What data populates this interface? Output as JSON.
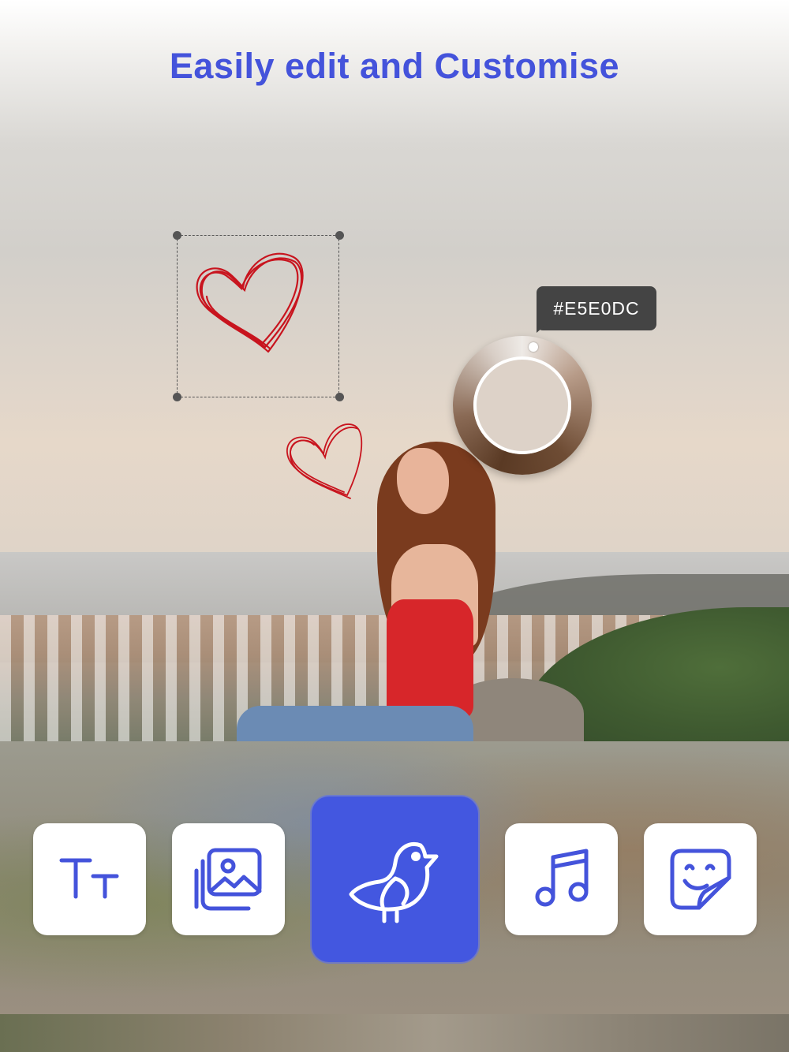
{
  "headline": "Easily edit and Customise",
  "color_picker": {
    "hex_label": "#E5E0DC",
    "selected_color": "#E5E0DC"
  },
  "colors": {
    "accent": "#4453DB",
    "active_tool_bg": "#4357E0",
    "heart_stroke": "#C8141E"
  },
  "toolbar": {
    "tools": [
      {
        "id": "text",
        "icon": "text-size-icon",
        "active": false
      },
      {
        "id": "images",
        "icon": "photo-gallery-icon",
        "active": false
      },
      {
        "id": "animals",
        "icon": "bird-icon",
        "active": true
      },
      {
        "id": "music",
        "icon": "music-note-icon",
        "active": false
      },
      {
        "id": "stickers",
        "icon": "sticker-icon",
        "active": false
      }
    ]
  }
}
